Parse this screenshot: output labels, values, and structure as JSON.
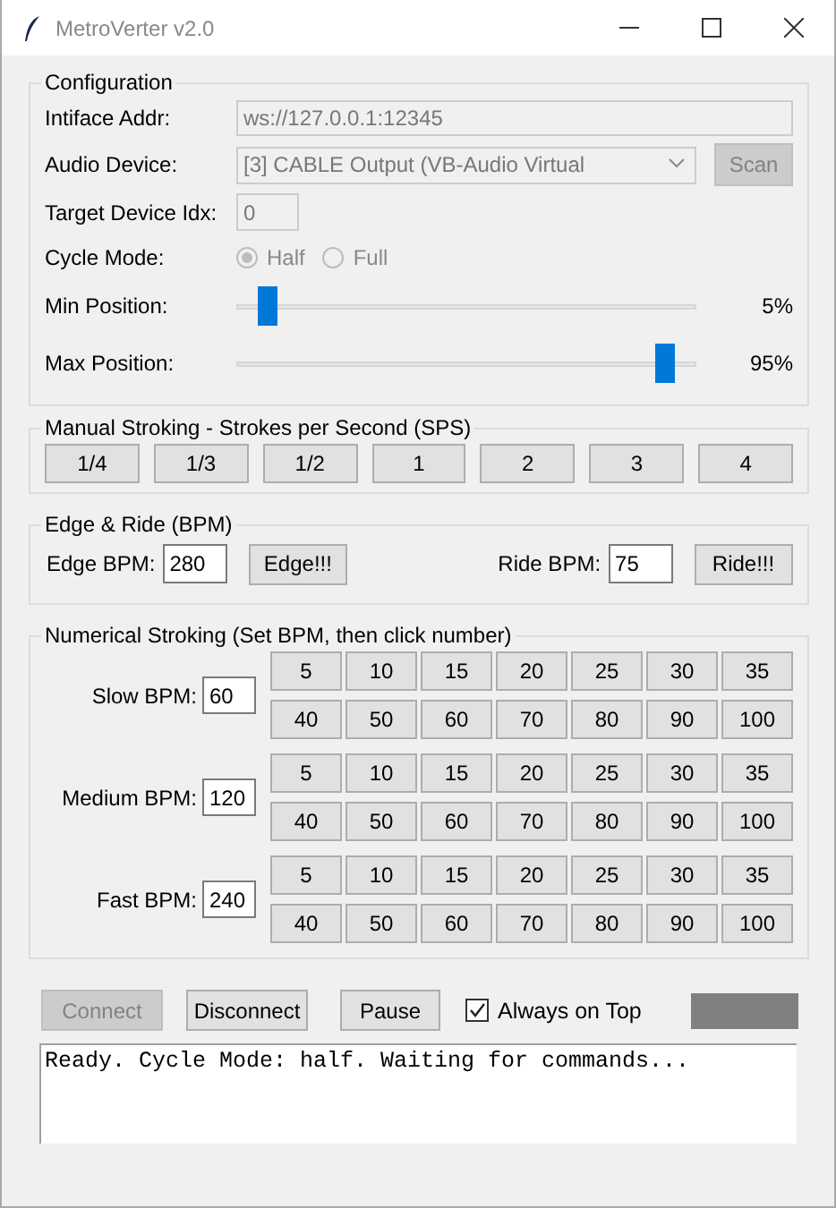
{
  "window": {
    "title": "MetroVerter v2.0"
  },
  "configuration": {
    "title": "Configuration",
    "interface_addr": {
      "label": "Intiface Addr:",
      "value": "ws://127.0.0.1:12345",
      "disabled": true
    },
    "audio_device": {
      "label": "Audio Device:",
      "value": "[3] CABLE Output (VB-Audio Virtual",
      "disabled": true,
      "scan": {
        "label": "Scan",
        "disabled": true
      }
    },
    "target_device_idx": {
      "label": "Target Device Idx:",
      "value": "0",
      "disabled": true
    },
    "cycle_mode": {
      "label": "Cycle Mode:",
      "disabled": true,
      "options": [
        {
          "label": "Half",
          "selected": true
        },
        {
          "label": "Full",
          "selected": false
        }
      ]
    },
    "sliders": [
      {
        "label": "Min Position:",
        "level": 0.05,
        "reading": "5%"
      },
      {
        "label": "Max Position:",
        "level": 0.95,
        "reading": "95%"
      }
    ]
  },
  "manual_stroking": {
    "title": "Manual Stroking - Strokes per Second (SPS)",
    "buttons": [
      "1/4",
      "1/3",
      "1/2",
      "1",
      "2",
      "3",
      "4"
    ]
  },
  "edge_ride": {
    "title": "Edge & Ride (BPM)",
    "items": [
      {
        "label": "Edge BPM:",
        "value": "280",
        "button": "Edge!!!"
      },
      {
        "label": "Ride BPM:",
        "value": "75",
        "button": "Ride!!!"
      }
    ]
  },
  "numerical_stroking": {
    "title": "Numerical Stroking (Set BPM, then click number)",
    "groups": [
      {
        "label": "Slow BPM:",
        "value": "60",
        "buttons": [
          "5",
          "10",
          "15",
          "20",
          "25",
          "30",
          "35",
          "40",
          "50",
          "60",
          "70",
          "80",
          "90",
          "100"
        ]
      },
      {
        "label": "Medium BPM:",
        "value": "120",
        "buttons": [
          "5",
          "10",
          "15",
          "20",
          "25",
          "30",
          "35",
          "40",
          "50",
          "60",
          "70",
          "80",
          "90",
          "100"
        ]
      },
      {
        "label": "Fast BPM:",
        "value": "240",
        "buttons": [
          "5",
          "10",
          "15",
          "20",
          "25",
          "30",
          "35",
          "40",
          "50",
          "60",
          "70",
          "80",
          "90",
          "100"
        ]
      }
    ]
  },
  "controls": {
    "buttons": [
      {
        "label": "Connect",
        "disabled": true
      },
      {
        "label": "Disconnect",
        "disabled": false
      },
      {
        "label": "Pause",
        "disabled": false
      }
    ],
    "always_on_top": {
      "label": "Always on Top",
      "checked": true
    },
    "status_indicator": {
      "color": "#808080"
    }
  },
  "log": {
    "text": "Ready. Cycle Mode: half. Waiting for commands..."
  }
}
